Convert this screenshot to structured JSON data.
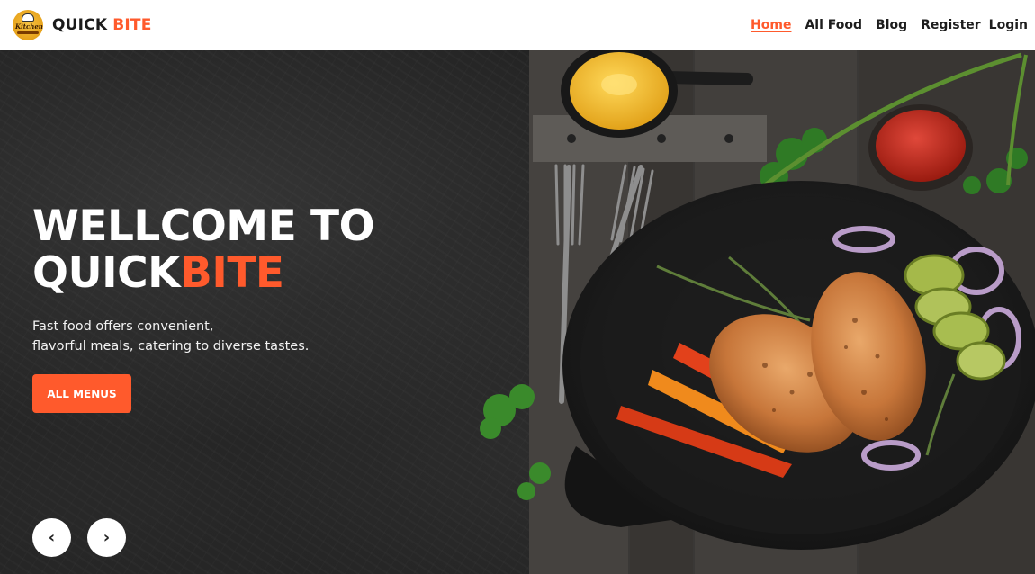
{
  "brand": {
    "name_part1": "QUICK",
    "name_part2": "BITE",
    "logo_text": "Kitchen"
  },
  "nav": {
    "home": "Home",
    "all_food": "All Food",
    "blog": "Blog",
    "register": "Register",
    "login": "Login"
  },
  "hero": {
    "title_line1": "WELLCOME TO",
    "title_line2_part1": "QUICK",
    "title_line2_part2": "BITE",
    "description_line1": "Fast food offers convenient,",
    "description_line2": "flavorful meals, catering to diverse tastes.",
    "cta_label": "ALL MENUS",
    "prev_arrow": "‹",
    "next_arrow": "›"
  },
  "colors": {
    "accent": "#ff5a2c",
    "header_bg": "#ffffff",
    "hero_bg": "#222222"
  },
  "icons": {
    "logo": "kitchen-chef-logo",
    "prev": "chevron-left-icon",
    "next": "chevron-right-icon"
  }
}
